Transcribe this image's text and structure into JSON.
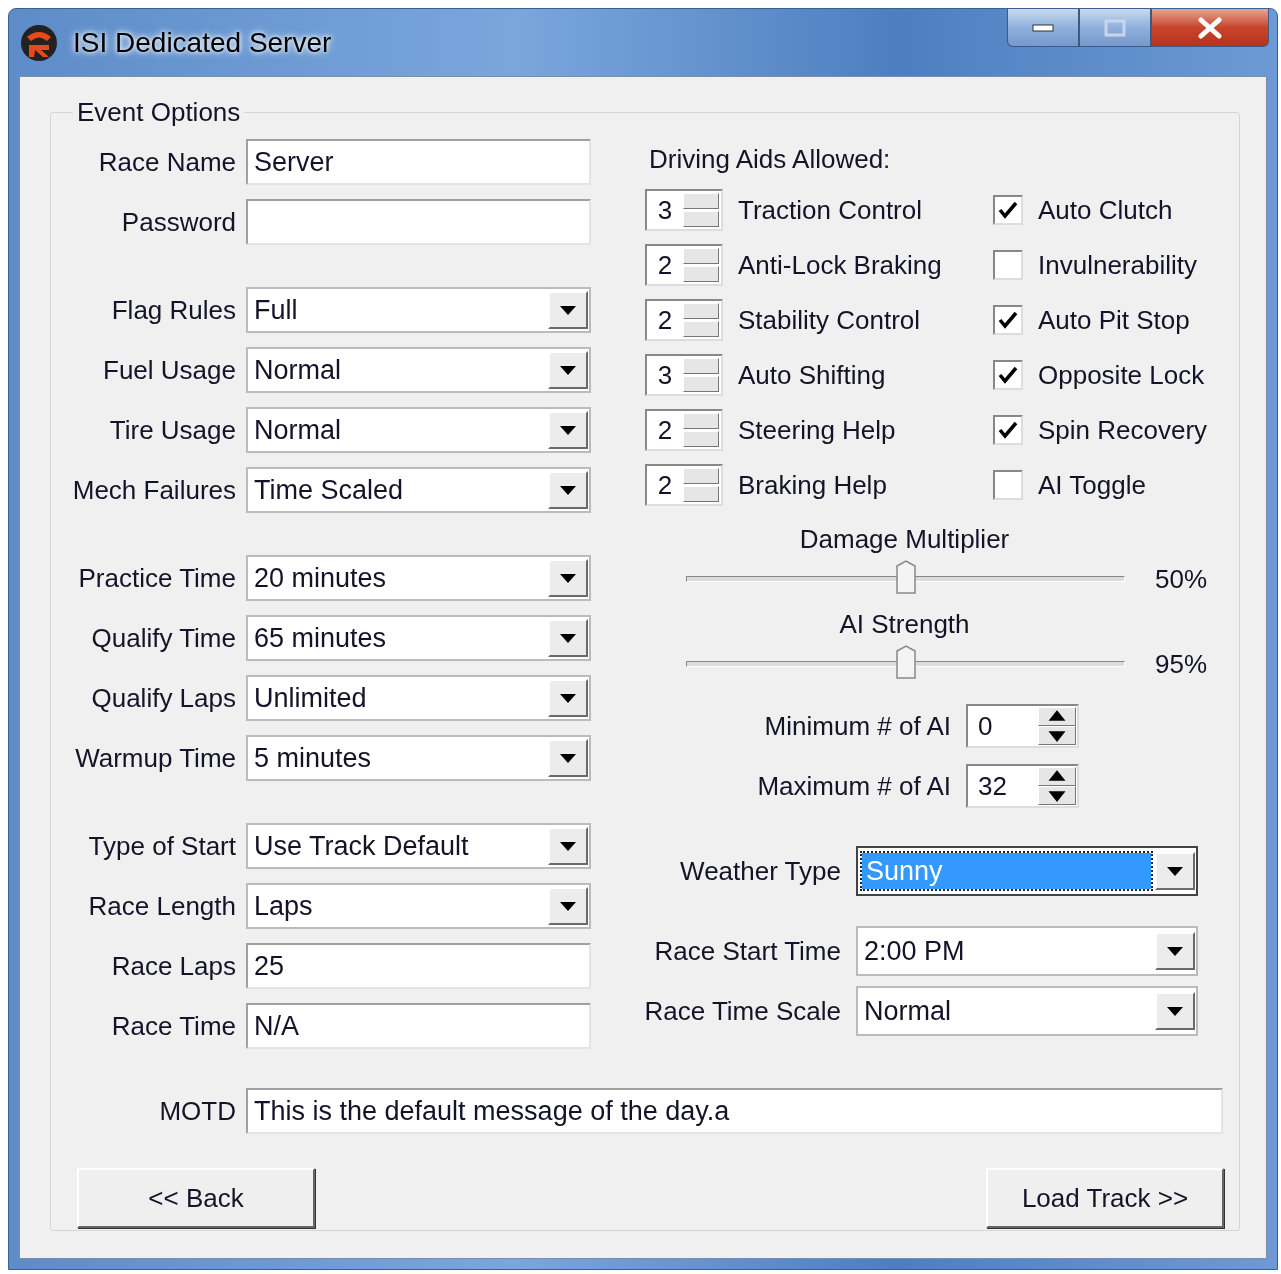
{
  "window": {
    "title": "ISI Dedicated Server"
  },
  "group": {
    "title": "Event Options"
  },
  "left_sections": [
    {
      "fields": [
        {
          "label": "Race Name",
          "kind": "text",
          "value": "Server"
        },
        {
          "label": "Password",
          "kind": "text"
        }
      ]
    },
    {
      "fields": [
        {
          "label": "Flag Rules",
          "kind": "combo",
          "value": "Full"
        },
        {
          "label": "Fuel Usage",
          "kind": "combo",
          "value": "Normal"
        },
        {
          "label": "Tire Usage",
          "kind": "combo",
          "value": "Normal"
        },
        {
          "label": "Mech Failures",
          "kind": "combo",
          "value": "Time Scaled"
        }
      ]
    },
    {
      "fields": [
        {
          "label": "Practice Time",
          "kind": "combo",
          "value": "20 minutes"
        },
        {
          "label": "Qualify Time",
          "kind": "combo",
          "value": "65 minutes"
        },
        {
          "label": "Qualify Laps",
          "kind": "combo",
          "value": "Unlimited"
        },
        {
          "label": "Warmup Time",
          "kind": "combo",
          "value": "5 minutes"
        }
      ]
    },
    {
      "fields": [
        {
          "label": "Type of Start",
          "kind": "combo",
          "value": "Use Track Default"
        },
        {
          "label": "Race Length",
          "kind": "combo",
          "value": "Laps"
        },
        {
          "label": "Race Laps",
          "kind": "text",
          "value": "25"
        },
        {
          "label": "Race Time",
          "kind": "text",
          "value": "N/A"
        }
      ]
    }
  ],
  "driving_aids": {
    "title": "Driving Aids Allowed:",
    "spinners": [
      {
        "value": "3",
        "label": "Traction Control"
      },
      {
        "value": "2",
        "label": "Anti-Lock Braking"
      },
      {
        "value": "2",
        "label": "Stability Control"
      },
      {
        "value": "3",
        "label": "Auto Shifting"
      },
      {
        "value": "2",
        "label": "Steering Help"
      },
      {
        "value": "2",
        "label": "Braking Help"
      }
    ],
    "checkboxes": [
      {
        "label": "Auto Clutch",
        "checked": true
      },
      {
        "label": "Invulnerability",
        "checked": false
      },
      {
        "label": "Auto Pit Stop",
        "checked": true
      },
      {
        "label": "Opposite Lock",
        "checked": true
      },
      {
        "label": "Spin Recovery",
        "checked": true
      },
      {
        "label": "AI Toggle",
        "checked": false
      }
    ]
  },
  "sliders": [
    {
      "label": "Damage Multiplier",
      "level": 0.5,
      "reading": "50%"
    },
    {
      "label": "AI Strength",
      "level": 0.5,
      "reading": "95%"
    }
  ],
  "ai_counts": [
    {
      "label": "Minimum # of AI",
      "value": "0"
    },
    {
      "label": "Maximum # of AI",
      "value": "32"
    }
  ],
  "right_combos": [
    {
      "label": "Weather Type",
      "value": "Sunny",
      "highlighted": true
    },
    {
      "label": "Race Start Time",
      "value": "2:00 PM",
      "highlighted": false
    },
    {
      "label": "Race Time Scale",
      "value": "Normal",
      "highlighted": false
    }
  ],
  "motd": {
    "label": "MOTD",
    "value": "This is the default message of the day.a"
  },
  "buttons": [
    {
      "label": "<< Back"
    },
    {
      "label": "Load Track >>"
    }
  ]
}
